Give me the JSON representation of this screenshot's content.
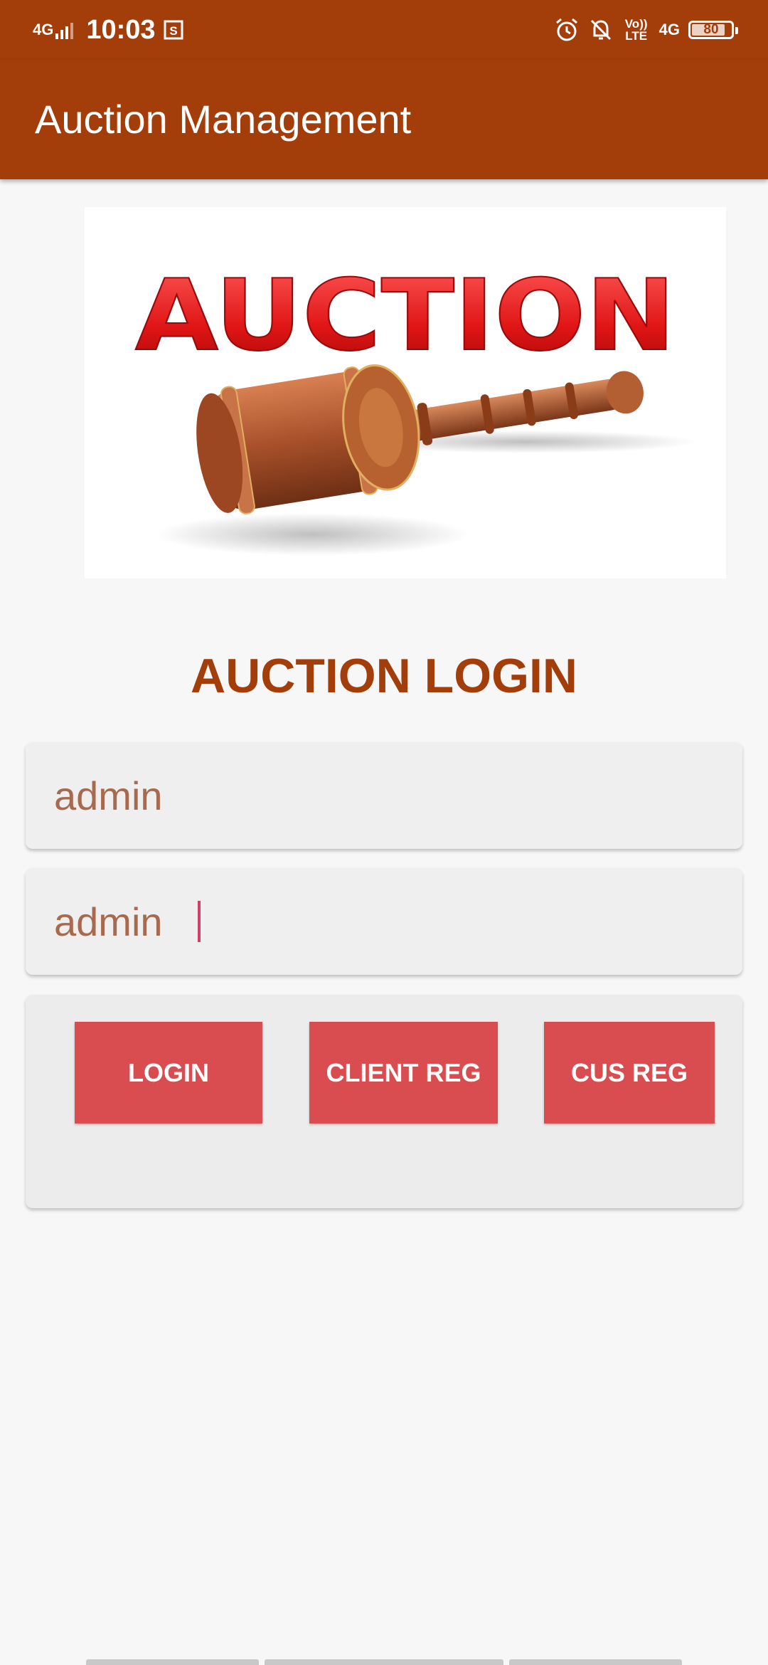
{
  "status_bar": {
    "network": "4G",
    "time": "10:03",
    "volte": "Vo)) LTE",
    "network_right": "4G",
    "battery_level": "80",
    "battery_fraction": 0.8
  },
  "app_bar": {
    "title": "Auction Management"
  },
  "banner": {
    "logo_text": "AUCTION"
  },
  "login": {
    "heading": "AUCTION LOGIN",
    "username_value": "admin",
    "password_value": "admin"
  },
  "actions": {
    "login_label": "LOGIN",
    "client_reg_label": "CLIENT REG",
    "cus_reg_label": "CUS REG"
  },
  "colors": {
    "primary": "#a33d0a",
    "button": "#d94c4f",
    "input_text": "#a86a4e",
    "caret": "#d43f6a",
    "background": "#f7f7f7"
  }
}
